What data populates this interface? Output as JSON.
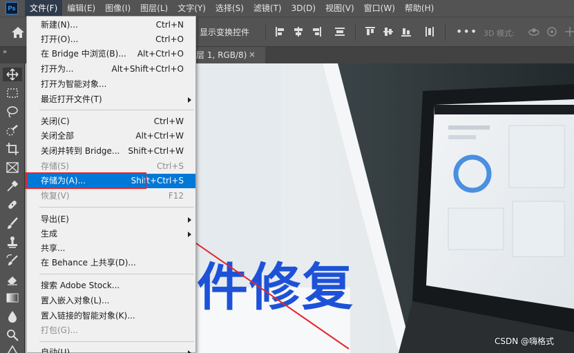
{
  "app": {
    "logo_text": "Ps"
  },
  "menubar": {
    "items": [
      {
        "label": "文件(F)"
      },
      {
        "label": "编辑(E)"
      },
      {
        "label": "图像(I)"
      },
      {
        "label": "图层(L)"
      },
      {
        "label": "文字(Y)"
      },
      {
        "label": "选择(S)"
      },
      {
        "label": "滤镜(T)"
      },
      {
        "label": "3D(D)"
      },
      {
        "label": "视图(V)"
      },
      {
        "label": "窗口(W)"
      },
      {
        "label": "帮助(H)"
      }
    ]
  },
  "options_bar": {
    "show_transform_label": "显示变换控件",
    "more_label": "•••",
    "mode3d_label": "3D 模式:"
  },
  "tab": {
    "title": "层 1, RGB/8)",
    "close_label": "×"
  },
  "panel_toggle": "»",
  "file_menu": {
    "groups": [
      [
        {
          "label": "新建(N)...",
          "shortcut": "Ctrl+N"
        },
        {
          "label": "打开(O)...",
          "shortcut": "Ctrl+O"
        },
        {
          "label": "在 Bridge 中浏览(B)...",
          "shortcut": "Alt+Ctrl+O"
        },
        {
          "label": "打开为...",
          "shortcut": "Alt+Shift+Ctrl+O"
        },
        {
          "label": "打开为智能对象..."
        },
        {
          "label": "最近打开文件(T)",
          "submenu": true
        }
      ],
      [
        {
          "label": "关闭(C)",
          "shortcut": "Ctrl+W"
        },
        {
          "label": "关闭全部",
          "shortcut": "Alt+Ctrl+W"
        },
        {
          "label": "关闭并转到 Bridge...",
          "shortcut": "Shift+Ctrl+W"
        },
        {
          "label": "存储(S)",
          "shortcut": "Ctrl+S",
          "disabled": true
        },
        {
          "label": "存储为(A)...",
          "shortcut": "Shift+Ctrl+S",
          "highlight": true
        },
        {
          "label": "恢复(V)",
          "shortcut": "F12",
          "disabled": true
        }
      ],
      [
        {
          "label": "导出(E)",
          "submenu": true
        },
        {
          "label": "生成",
          "submenu": true
        },
        {
          "label": "共享..."
        },
        {
          "label": "在 Behance 上共享(D)..."
        }
      ],
      [
        {
          "label": "搜索 Adobe Stock..."
        },
        {
          "label": "置入嵌入对象(L)..."
        },
        {
          "label": "置入链接的智能对象(K)..."
        },
        {
          "label": "打包(G)...",
          "disabled": true
        }
      ],
      [
        {
          "label": "自动(U)",
          "submenu": true
        }
      ]
    ]
  },
  "canvas": {
    "headline": "件修复"
  },
  "watermark": "CSDN @嗨格式",
  "colors": {
    "menu_highlight": "#0078d7",
    "annotation_red": "#e3262b",
    "headline_blue": "#1d52d8"
  }
}
